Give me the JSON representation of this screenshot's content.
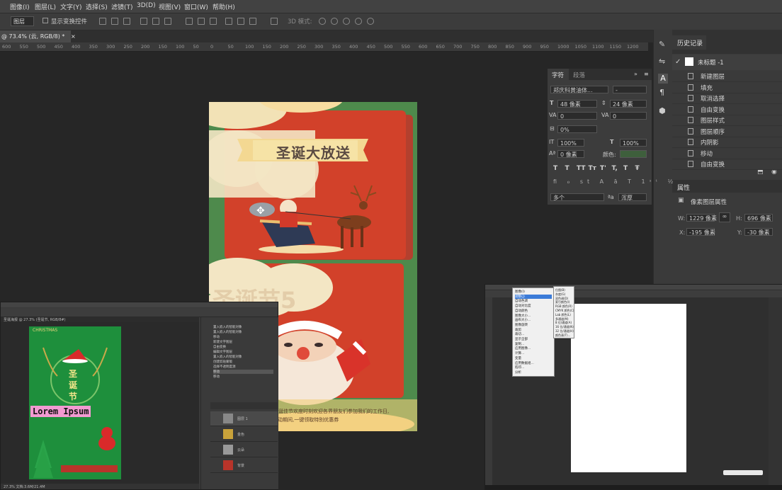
{
  "menubar": {
    "items": [
      "图像(I)",
      "图层(L)",
      "文字(Y)",
      "选择(S)",
      "滤镜(T)",
      "3D(D)",
      "视图(V)",
      "窗口(W)",
      "帮助(H)"
    ]
  },
  "options": {
    "select_value": "图层",
    "show_transform": "显示变换控件",
    "mode_3d": "3D 模式:"
  },
  "document_tab": {
    "title": "@ 73.4% (云, RGB/8) *",
    "close": "×"
  },
  "ruler": {
    "ticks": [
      "600",
      "550",
      "500",
      "450",
      "400",
      "350",
      "300",
      "250",
      "200",
      "150",
      "100",
      "50",
      "0",
      "50",
      "100",
      "150",
      "200",
      "250",
      "300",
      "350",
      "400",
      "450",
      "500",
      "550",
      "600",
      "650",
      "700",
      "750",
      "800",
      "850",
      "900",
      "950",
      "1000",
      "1050",
      "1100",
      "1150",
      "1200"
    ]
  },
  "poster": {
    "banner": "圣诞大放送",
    "bottom_text_1": "在这个圣诞佳节欢度时刻欢迎各界朋友们参加我们的工作日,",
    "bottom_text_2": "活动期间,一键领取特别优惠券",
    "ghost_text": "圣诞节5"
  },
  "history_panel": {
    "title": "历史记录",
    "snapshot": "未标题 -1",
    "items": [
      "新建图层",
      "填充",
      "取消选择",
      "自由变换",
      "图层样式",
      "图层顺序",
      "内阴影",
      "移动",
      "自由变换"
    ],
    "properties_title": "属性",
    "properties_subtitle": "像素图层属性",
    "w_label": "W:",
    "w_value": "1229 像素",
    "h_label": "H:",
    "h_value": "696 像素",
    "x_label": "X:",
    "x_value": "-195 像素",
    "y_label": "Y:",
    "y_value": "-30 像素"
  },
  "character_panel": {
    "tab_char": "字符",
    "tab_para": "段落",
    "font_family": "郑庆科黄油体...",
    "font_style": "-",
    "size": "48 像素",
    "leading": "24 像素",
    "kerning": "0",
    "tracking": "0",
    "tsume": "0%",
    "vscale": "100%",
    "hscale": "100%",
    "baseline": "0 像素",
    "color_label": "颜色:",
    "color_value": "#3e5f3c",
    "language": "多个",
    "antialias": "浑厚",
    "styles": [
      "T",
      "T",
      "TT",
      "Tт",
      "T'",
      "T,",
      "T",
      "Ŧ"
    ]
  },
  "left_window": {
    "tab": "圣诞海报 @ 27.3% (圣诞节, RGB/8#)",
    "christmas_title": "CHRISTMAS",
    "sheng": "圣",
    "dan": "诞",
    "jie": "节",
    "lorem": "Lorem Ipsum",
    "status": "27.3%  文档:3.6M/21.4M",
    "layers": [
      "置入嵌入的智能对象",
      "置入嵌入的智能对象",
      "移动",
      "新建文字图层",
      "自由变换",
      "编辑文字图层",
      "置入嵌入的智能对象",
      "创建剪贴蒙版",
      "选择不透明度源",
      "移动",
      "移动"
    ],
    "layer_names": [
      "图层 1",
      "金色",
      "云朵",
      "背景"
    ]
  },
  "right_window": {
    "menu_items": [
      "图像(I)",
      "调整(J)",
      "自动色调",
      "自动对比度",
      "自动颜色",
      "图像大小...",
      "画布大小...",
      "图像旋转",
      "裁剪",
      "裁切...",
      "显示全部",
      "复制...",
      "应用图像...",
      "计算...",
      "变量",
      "应用数据组...",
      "陷印...",
      "分析"
    ],
    "submenu": [
      "位图(B)",
      "灰度(G)",
      "双色调(D)",
      "索引颜色(I)",
      "RGB 颜色(R)",
      "CMYK 颜色(C)",
      "Lab 颜色(L)",
      "多通道(M)",
      "8 位/通道(A)",
      "16 位/通道(N)",
      "32 位/通道(H)",
      "颜色表(T)..."
    ]
  }
}
